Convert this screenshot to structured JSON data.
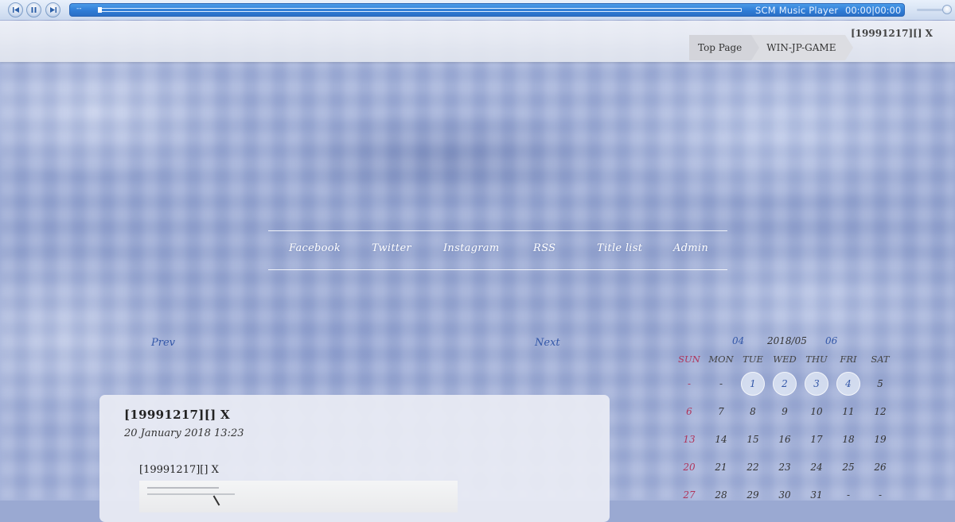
{
  "player": {
    "title": "SCM Music Player",
    "time": "00:00|00:00",
    "track_text": "--",
    "progress": 0,
    "volume": 0.8,
    "accent_color": "#2f7dd6"
  },
  "header": {
    "post_title": "[19991217][]  X",
    "breadcrumbs": [
      "Top Page",
      "WIN-JP-GAME"
    ]
  },
  "nav": {
    "items": [
      "Facebook",
      "Twitter",
      "Instagram",
      "RSS",
      "Title list",
      "Admin"
    ]
  },
  "pager": {
    "prev": "Prev",
    "next": "Next"
  },
  "article": {
    "title": "[19991217][]  X",
    "date": "20 January 2018 13:23",
    "body_title": "[19991217][]  X"
  },
  "calendar": {
    "prev_month": "04",
    "current_month": "2018/05",
    "next_month": "06",
    "weekdays": [
      "SUN",
      "MON",
      "TUE",
      "WED",
      "THU",
      "FRI",
      "SAT"
    ],
    "weeks": [
      [
        "-",
        "-",
        "1",
        "2",
        "3",
        "4",
        "5"
      ],
      [
        "6",
        "7",
        "8",
        "9",
        "10",
        "11",
        "12"
      ],
      [
        "13",
        "14",
        "15",
        "16",
        "17",
        "18",
        "19"
      ],
      [
        "20",
        "21",
        "22",
        "23",
        "24",
        "25",
        "26"
      ],
      [
        "27",
        "28",
        "29",
        "30",
        "31",
        "-",
        "-"
      ]
    ],
    "posted_days": [
      "1",
      "2",
      "3",
      "4"
    ],
    "sunday_color": "#b0345a",
    "link_color": "#3357a8"
  }
}
